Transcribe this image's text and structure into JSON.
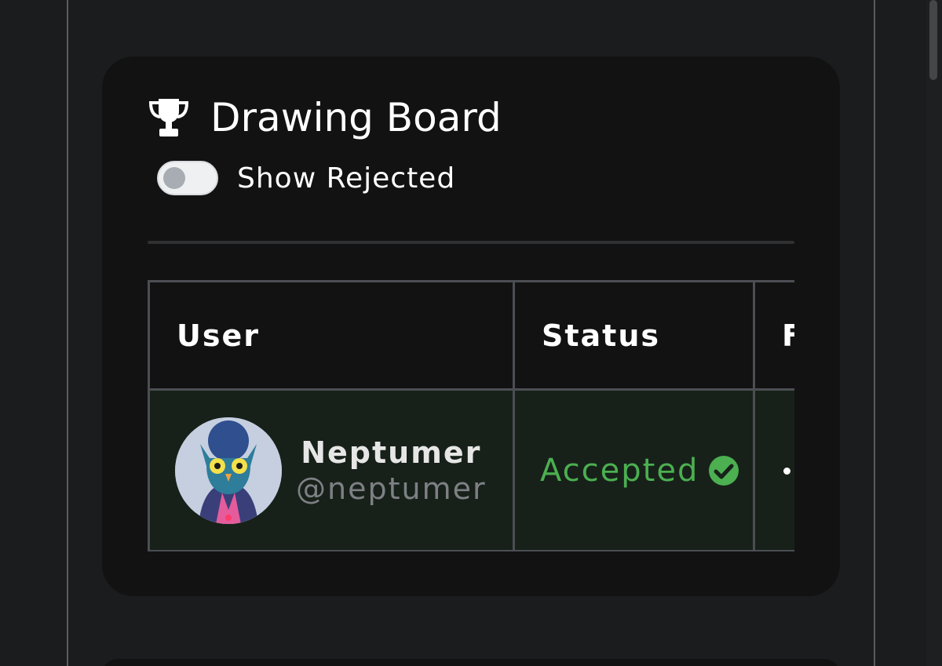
{
  "card": {
    "title": "Drawing Board",
    "title_icon": "trophy-icon",
    "toggle": {
      "label": "Show Rejected",
      "checked": false
    }
  },
  "table": {
    "headers": [
      "User",
      "Status",
      "F"
    ],
    "rows": [
      {
        "user": {
          "name": "Neptumer",
          "handle": "@neptumer"
        },
        "status": {
          "text": "Accepted",
          "icon": "check-circle-icon"
        },
        "third": "•"
      }
    ]
  },
  "colors": {
    "accepted": "#4caf50",
    "row_bg": "#17211a",
    "card_bg": "#121213",
    "page_bg": "#1b1c1e"
  }
}
